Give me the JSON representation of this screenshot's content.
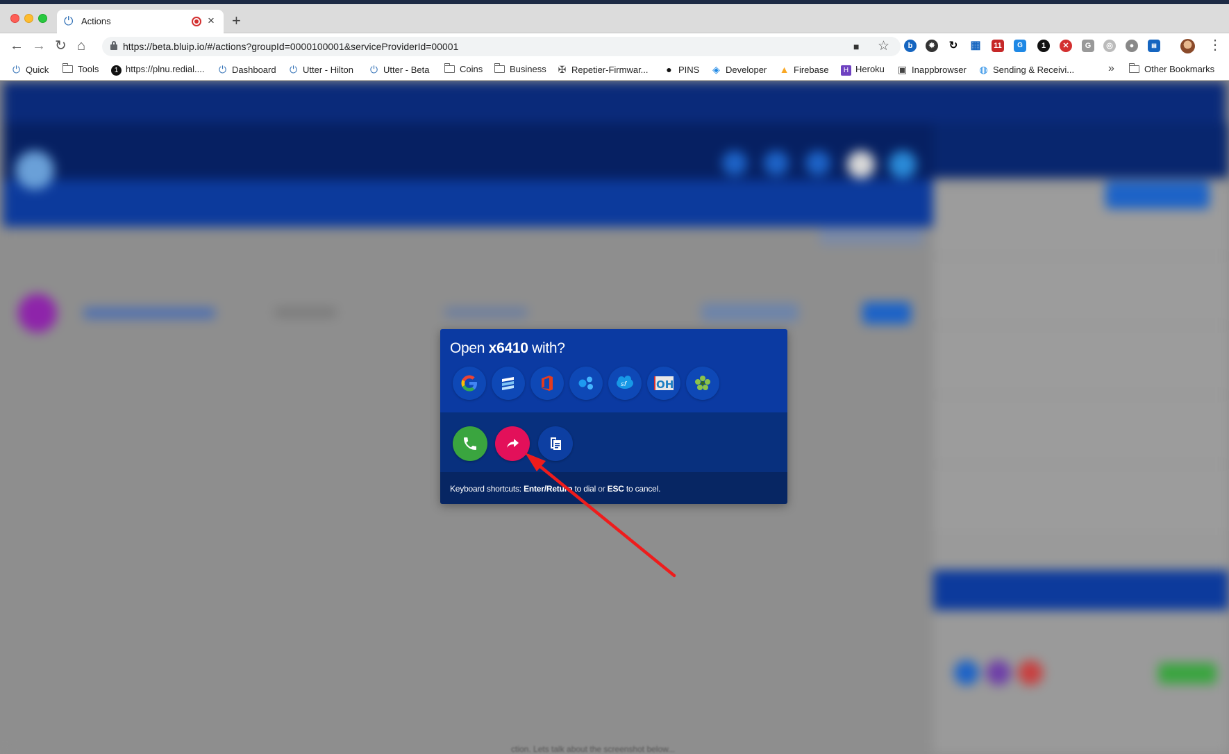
{
  "browser": {
    "tab_title": "Actions",
    "url": "https://beta.bluip.io/#/actions?groupId=0000100001&serviceProviderId=00001",
    "bookmarks": [
      {
        "label": "Quick",
        "icon": "power-icon"
      },
      {
        "label": "Tools",
        "icon": "folder-icon"
      },
      {
        "label": "https://plnu.redial....",
        "icon": "info-circle-icon"
      },
      {
        "label": "Dashboard",
        "icon": "power-icon"
      },
      {
        "label": "Utter - Hilton",
        "icon": "power-icon"
      },
      {
        "label": "Utter - Beta",
        "icon": "power-icon"
      },
      {
        "label": "Coins",
        "icon": "folder-icon"
      },
      {
        "label": "Business",
        "icon": "folder-icon"
      },
      {
        "label": "Repetier-Firmwar...",
        "icon": "gear-icon"
      },
      {
        "label": "PINS",
        "icon": "github-icon"
      },
      {
        "label": "Developer",
        "icon": "developer-icon"
      },
      {
        "label": "Firebase",
        "icon": "firebase-icon"
      },
      {
        "label": "Heroku",
        "icon": "heroku-icon"
      },
      {
        "label": "Inappbrowser",
        "icon": "browser-icon"
      },
      {
        "label": "Sending & Receivi...",
        "icon": "globe-icon"
      }
    ],
    "other_bookmarks": "Other Bookmarks",
    "extension_badge": "11"
  },
  "modal": {
    "title_prefix": "Open ",
    "title_target": "x6410",
    "title_suffix": " with?",
    "apps": [
      "google-icon",
      "stack-icon",
      "office-icon",
      "dots-app-icon",
      "salesforce-icon",
      "oh-app-icon",
      "flower-app-icon"
    ],
    "actions": [
      "call-icon",
      "forward-icon",
      "copy-icon"
    ],
    "shortcut_prefix": "Keyboard shortcuts: ",
    "shortcut_key1": "Enter/Return",
    "shortcut_mid1": " to dial ",
    "shortcut_or": "or",
    "shortcut_key2": "ESC",
    "shortcut_end": " to cancel."
  },
  "annotation": {
    "color": "#ee1c1c",
    "points_to": "forward-button"
  },
  "colors": {
    "modal_top": "#0b3aa2",
    "call": "#3aa53f",
    "forward": "#e3105a"
  }
}
